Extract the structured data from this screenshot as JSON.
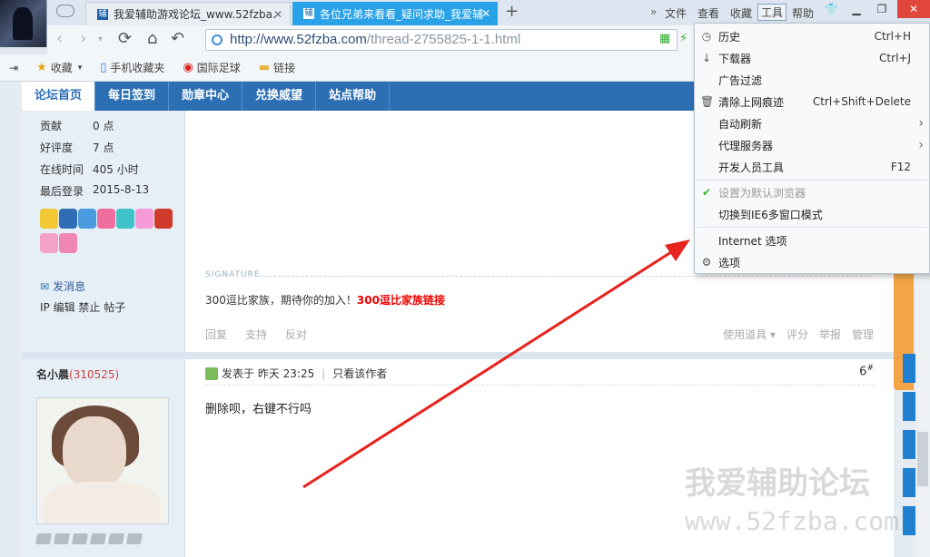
{
  "browser": {
    "tabs": [
      {
        "label": "我爱辅助游戏论坛_www.52fzba.",
        "icon": "辅"
      },
      {
        "label": "各位兄弟来看看_疑问求助_我爱辅",
        "icon": "辅"
      }
    ],
    "new_tab": "+",
    "menus": {
      "more": "»",
      "file": "文件",
      "view": "查看",
      "favorites": "收藏",
      "tools": "工具",
      "help": "帮助"
    },
    "url_host": "http://www.52fzba.com",
    "url_path": "/thread-2755825-1-1.html"
  },
  "bookmarks": [
    {
      "label": "收藏",
      "icon": "star-icon"
    },
    {
      "label": "手机收藏夹",
      "icon": "phone-icon"
    },
    {
      "label": "国际足球",
      "icon": "weibo-icon"
    },
    {
      "label": "链接",
      "icon": "folder-icon"
    }
  ],
  "forum": {
    "nav": [
      "论坛首页",
      "每日签到",
      "勋章中心",
      "兑换威望",
      "站点帮助"
    ],
    "user1_stats": [
      {
        "k": "贡献",
        "v": "0 点"
      },
      {
        "k": "好评度",
        "v": "7 点"
      },
      {
        "k": "在线时间",
        "v": "405 小时"
      },
      {
        "k": "最后登录",
        "v": "2015-8-13"
      }
    ],
    "send_message": "发消息",
    "admin_links": "IP 编辑 禁止 帖子",
    "signature_label": "SIGNATURE",
    "signature_text": "300逗比家族，期待你的加入！",
    "signature_link": "300逗比家族链接",
    "post_actions": [
      "回复",
      "支持",
      "反对"
    ],
    "post_tools": [
      "使用道具 ▾",
      "评分",
      "举报",
      "管理"
    ],
    "user2_name": "名小晨",
    "user2_uid": "(310525)",
    "post2_posted": "发表于 昨天 23:25",
    "post2_author_only": "只看该作者",
    "post2_floor": "6",
    "post2_floor_sup": "#",
    "post2_body": "删除呗，右键不行吗"
  },
  "watermark": {
    "line1": "我爱辅助论坛",
    "line2": "www.52fzba.com"
  },
  "tools_menu": [
    {
      "label": "历史",
      "shortcut": "Ctrl+H",
      "icon": "clock-icon"
    },
    {
      "label": "下载器",
      "shortcut": "Ctrl+J",
      "icon": "download-icon"
    },
    {
      "label": "广告过滤",
      "shortcut": "",
      "icon": ""
    },
    {
      "label": "清除上网痕迹",
      "shortcut": "Ctrl+Shift+Delete",
      "icon": "trash-icon"
    },
    {
      "label": "自动刷新",
      "shortcut": "",
      "icon": "",
      "submenu": true
    },
    {
      "label": "代理服务器",
      "shortcut": "",
      "icon": "",
      "submenu": true
    },
    {
      "label": "开发人员工具",
      "shortcut": "F12",
      "icon": ""
    },
    {
      "label": "设置为默认浏览器",
      "shortcut": "",
      "icon": "check-icon",
      "disabled": true
    },
    {
      "label": "切换到IE6多窗口模式",
      "shortcut": "",
      "icon": ""
    },
    {
      "label": "Internet 选项",
      "shortcut": "",
      "icon": ""
    },
    {
      "label": "选项",
      "shortcut": "",
      "icon": "gear-icon"
    }
  ]
}
